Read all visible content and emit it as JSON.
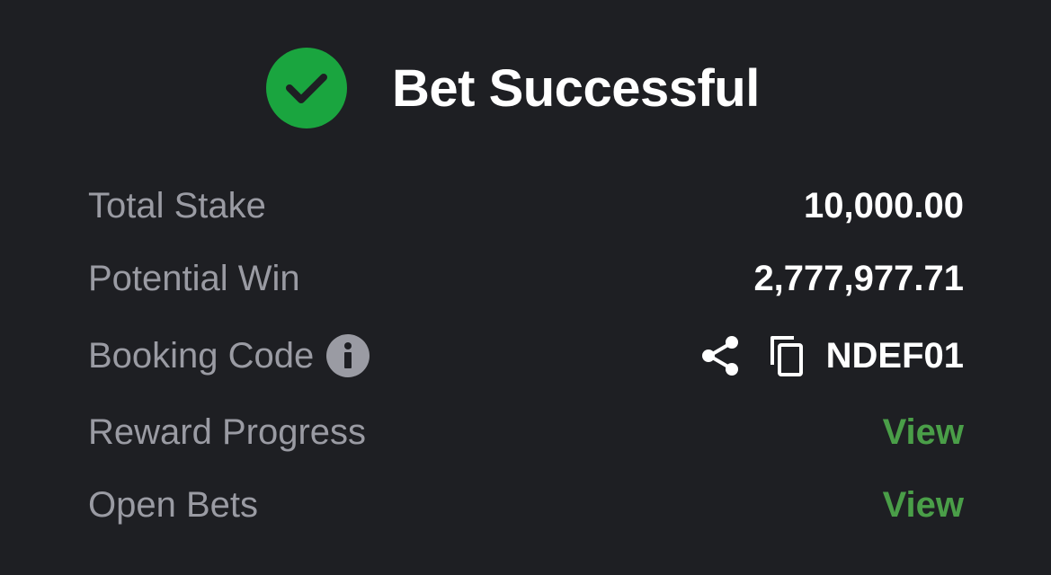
{
  "header": {
    "title": "Bet Successful",
    "status_icon": "check-circle-icon",
    "status_color": "#1aa53f"
  },
  "details": {
    "total_stake": {
      "label": "Total Stake",
      "value": "10,000.00"
    },
    "potential_win": {
      "label": "Potential Win",
      "value": "2,777,977.71"
    },
    "booking_code": {
      "label": "Booking Code",
      "value": "NDEF01",
      "info_icon": "info-icon",
      "share_icon": "share-icon",
      "copy_icon": "copy-icon"
    },
    "reward_progress": {
      "label": "Reward Progress",
      "link": "View"
    },
    "open_bets": {
      "label": "Open Bets",
      "link": "View"
    }
  },
  "colors": {
    "background": "#1e1f23",
    "label": "#9a9ba3",
    "value": "#ffffff",
    "link": "#4a9e48",
    "success": "#1aa53f"
  }
}
